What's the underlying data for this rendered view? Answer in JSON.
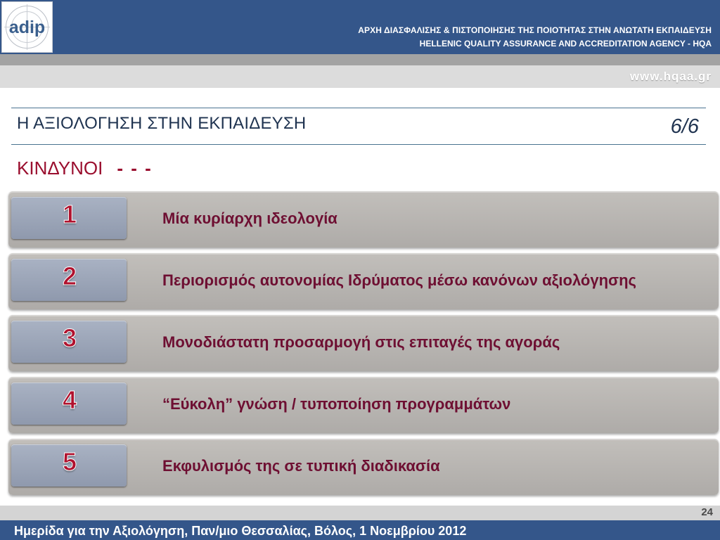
{
  "header": {
    "agency_name_greek": "ΑΡΧΗ ΔΙΑΣΦΑΛΙΣΗΣ & ΠΙΣΤΟΠΟΙΗΣΗΣ ΤΗΣ ΠΟΙΟΤΗΤΑΣ ΣΤΗΝ ΑΝΩΤΑΤΗ ΕΚΠΑΙΔΕΥΣΗ",
    "agency_name_english": "HELLENIC QUALITY ASSURANCE AND ACCREDITATION AGENCY - HQA",
    "website": "www.hqaa.gr",
    "logo_icon": "hqaa-logo-icon"
  },
  "slide": {
    "title": "Η ΑΞΙΟΛΟΓΗΣΗ ΣΤΗΝ ΕΚΠΑΙΔΕΥΣΗ",
    "counter": "6/6",
    "section_title": "ΚΙΝΔΥΝΟΙ",
    "section_suffix": "- - -"
  },
  "risks": [
    {
      "number": "1",
      "text": "Μία κυρίαρχη ιδεολογία"
    },
    {
      "number": "2",
      "text": "Περιορισμός αυτονομίας Ιδρύματος μέσω κανόνων αξιολόγησης"
    },
    {
      "number": "3",
      "text": "Μονοδιάστατη προσαρμογή στις επιταγές της αγοράς"
    },
    {
      "number": "4",
      "text": "“Εύκολη” γνώση / τυποποίηση προγραμμάτων"
    },
    {
      "number": "5",
      "text": "Εκφυλισμός της σε τυπική διαδικασία"
    }
  ],
  "footer": {
    "page_number": "24",
    "event": "Ημερίδα για την Αξιολόγηση, Παν/μιο Θεσσαλίας, Βόλος, 1 Νοεμβρίου 2012"
  },
  "colors": {
    "header_blue": "#34568a",
    "accent_red": "#9a0e2e",
    "risk_text": "#6e0f32",
    "title_navy": "#1f3350"
  }
}
